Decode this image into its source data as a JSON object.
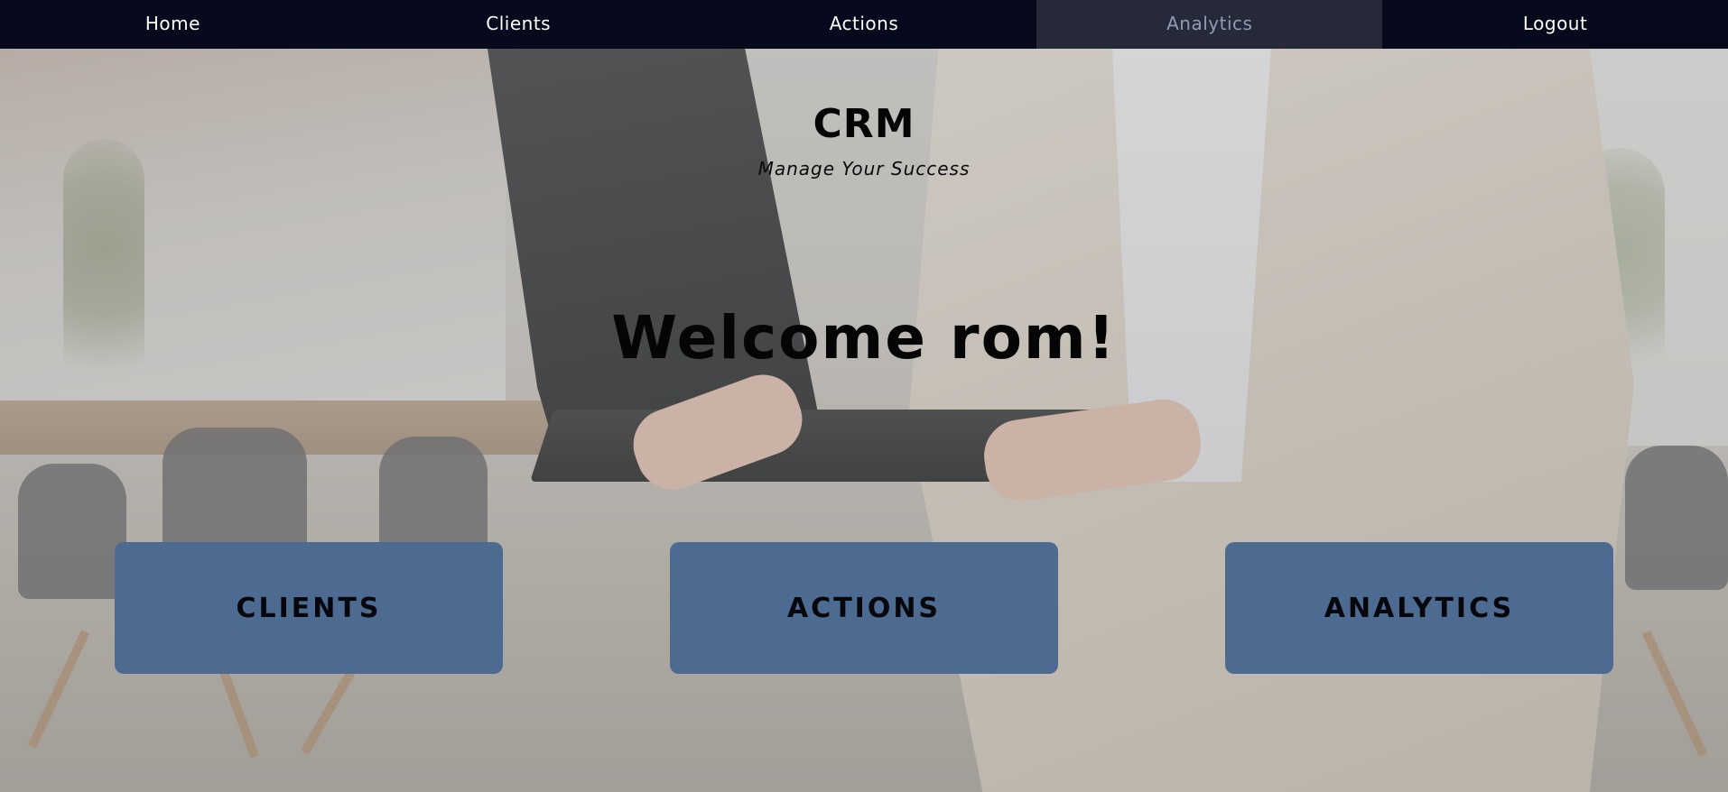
{
  "nav": {
    "items": [
      {
        "label": "Home",
        "active": false
      },
      {
        "label": "Clients",
        "active": false
      },
      {
        "label": "Actions",
        "active": false
      },
      {
        "label": "Analytics",
        "active": true
      },
      {
        "label": "Logout",
        "active": false
      }
    ]
  },
  "hero": {
    "title": "CRM",
    "subtitle": "Manage Your Success",
    "welcome": "Welcome rom!"
  },
  "cards": [
    {
      "label": "CLIENTS"
    },
    {
      "label": "ACTIONS"
    },
    {
      "label": "ANALYTICS"
    }
  ],
  "colors": {
    "nav_background": "#070a1c",
    "nav_active_background": "#262a38",
    "nav_active_text": "#8f9bb6",
    "card_background": "#4d6a91",
    "text_dark": "#050505"
  }
}
